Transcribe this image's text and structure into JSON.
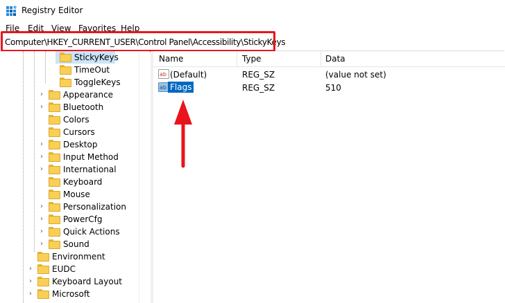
{
  "window": {
    "title": "Registry Editor"
  },
  "menu": [
    "File",
    "Edit",
    "View",
    "Favorites",
    "Help"
  ],
  "address": {
    "path": "Computer\\HKEY_CURRENT_USER\\Control Panel\\Accessibility\\StickyKeys"
  },
  "tree": {
    "items": [
      {
        "label": "StickyKeys",
        "expandable": false,
        "selected": true
      },
      {
        "label": "TimeOut",
        "expandable": false
      },
      {
        "label": "ToggleKeys",
        "expandable": false
      },
      {
        "label": "Appearance",
        "expandable": true
      },
      {
        "label": "Bluetooth",
        "expandable": true
      },
      {
        "label": "Colors",
        "expandable": false
      },
      {
        "label": "Cursors",
        "expandable": false
      },
      {
        "label": "Desktop",
        "expandable": true
      },
      {
        "label": "Input Method",
        "expandable": true
      },
      {
        "label": "International",
        "expandable": true
      },
      {
        "label": "Keyboard",
        "expandable": false
      },
      {
        "label": "Mouse",
        "expandable": false
      },
      {
        "label": "Personalization",
        "expandable": true
      },
      {
        "label": "PowerCfg",
        "expandable": true
      },
      {
        "label": "Quick Actions",
        "expandable": true
      },
      {
        "label": "Sound",
        "expandable": true
      },
      {
        "label": "Environment",
        "expandable": false
      },
      {
        "label": "EUDC",
        "expandable": true
      },
      {
        "label": "Keyboard Layout",
        "expandable": true
      },
      {
        "label": "Microsoft",
        "expandable": true
      }
    ]
  },
  "list": {
    "columns": [
      "Name",
      "Type",
      "Data"
    ],
    "rows": [
      {
        "icon": "string-value-icon",
        "name": "(Default)",
        "type": "REG_SZ",
        "data": "(value not set)",
        "selected": false
      },
      {
        "icon": "string-value-icon",
        "name": "Flags",
        "type": "REG_SZ",
        "data": "510",
        "selected": true
      }
    ]
  },
  "colors": {
    "highlight_red": "#e8151c",
    "selection_blue": "#0067c0",
    "tree_selection": "#cce4f7",
    "folder_yellow": "#f9cf56"
  }
}
